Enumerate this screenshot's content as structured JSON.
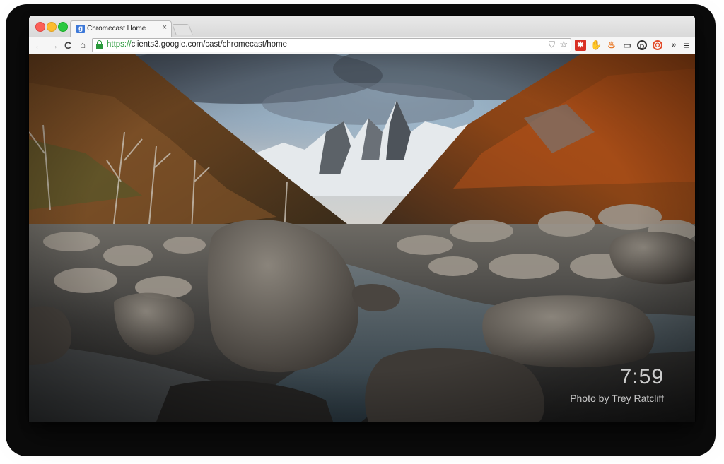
{
  "browser": {
    "tab": {
      "favicon_letter": "g",
      "title": "Chromecast Home",
      "close_glyph": "×"
    },
    "toolbar": {
      "back_glyph": "←",
      "forward_glyph": "→",
      "reload_glyph": "C",
      "home_glyph": "⌂",
      "url_scheme": "https://",
      "url_rest": "clients3.google.com/cast/chromecast/home",
      "star_glyph": "☆",
      "shield_glyph": "⛉"
    },
    "extensions": {
      "ext1_glyph": "✱",
      "ext2_glyph": "✋",
      "ext3_glyph": "♨",
      "ext4_glyph": "▭",
      "ext5_glyph": "D",
      "ext6_glyph": "O",
      "more_glyph": "»",
      "menu_glyph": "≡"
    }
  },
  "page": {
    "clock": "7:59",
    "photo_credit": "Photo by Trey Ratcliff"
  },
  "colors": {
    "accent_green": "#2a9a3c",
    "traffic_red": "#fc5f57",
    "traffic_yellow": "#fdbc2e",
    "traffic_green": "#2bc840"
  }
}
